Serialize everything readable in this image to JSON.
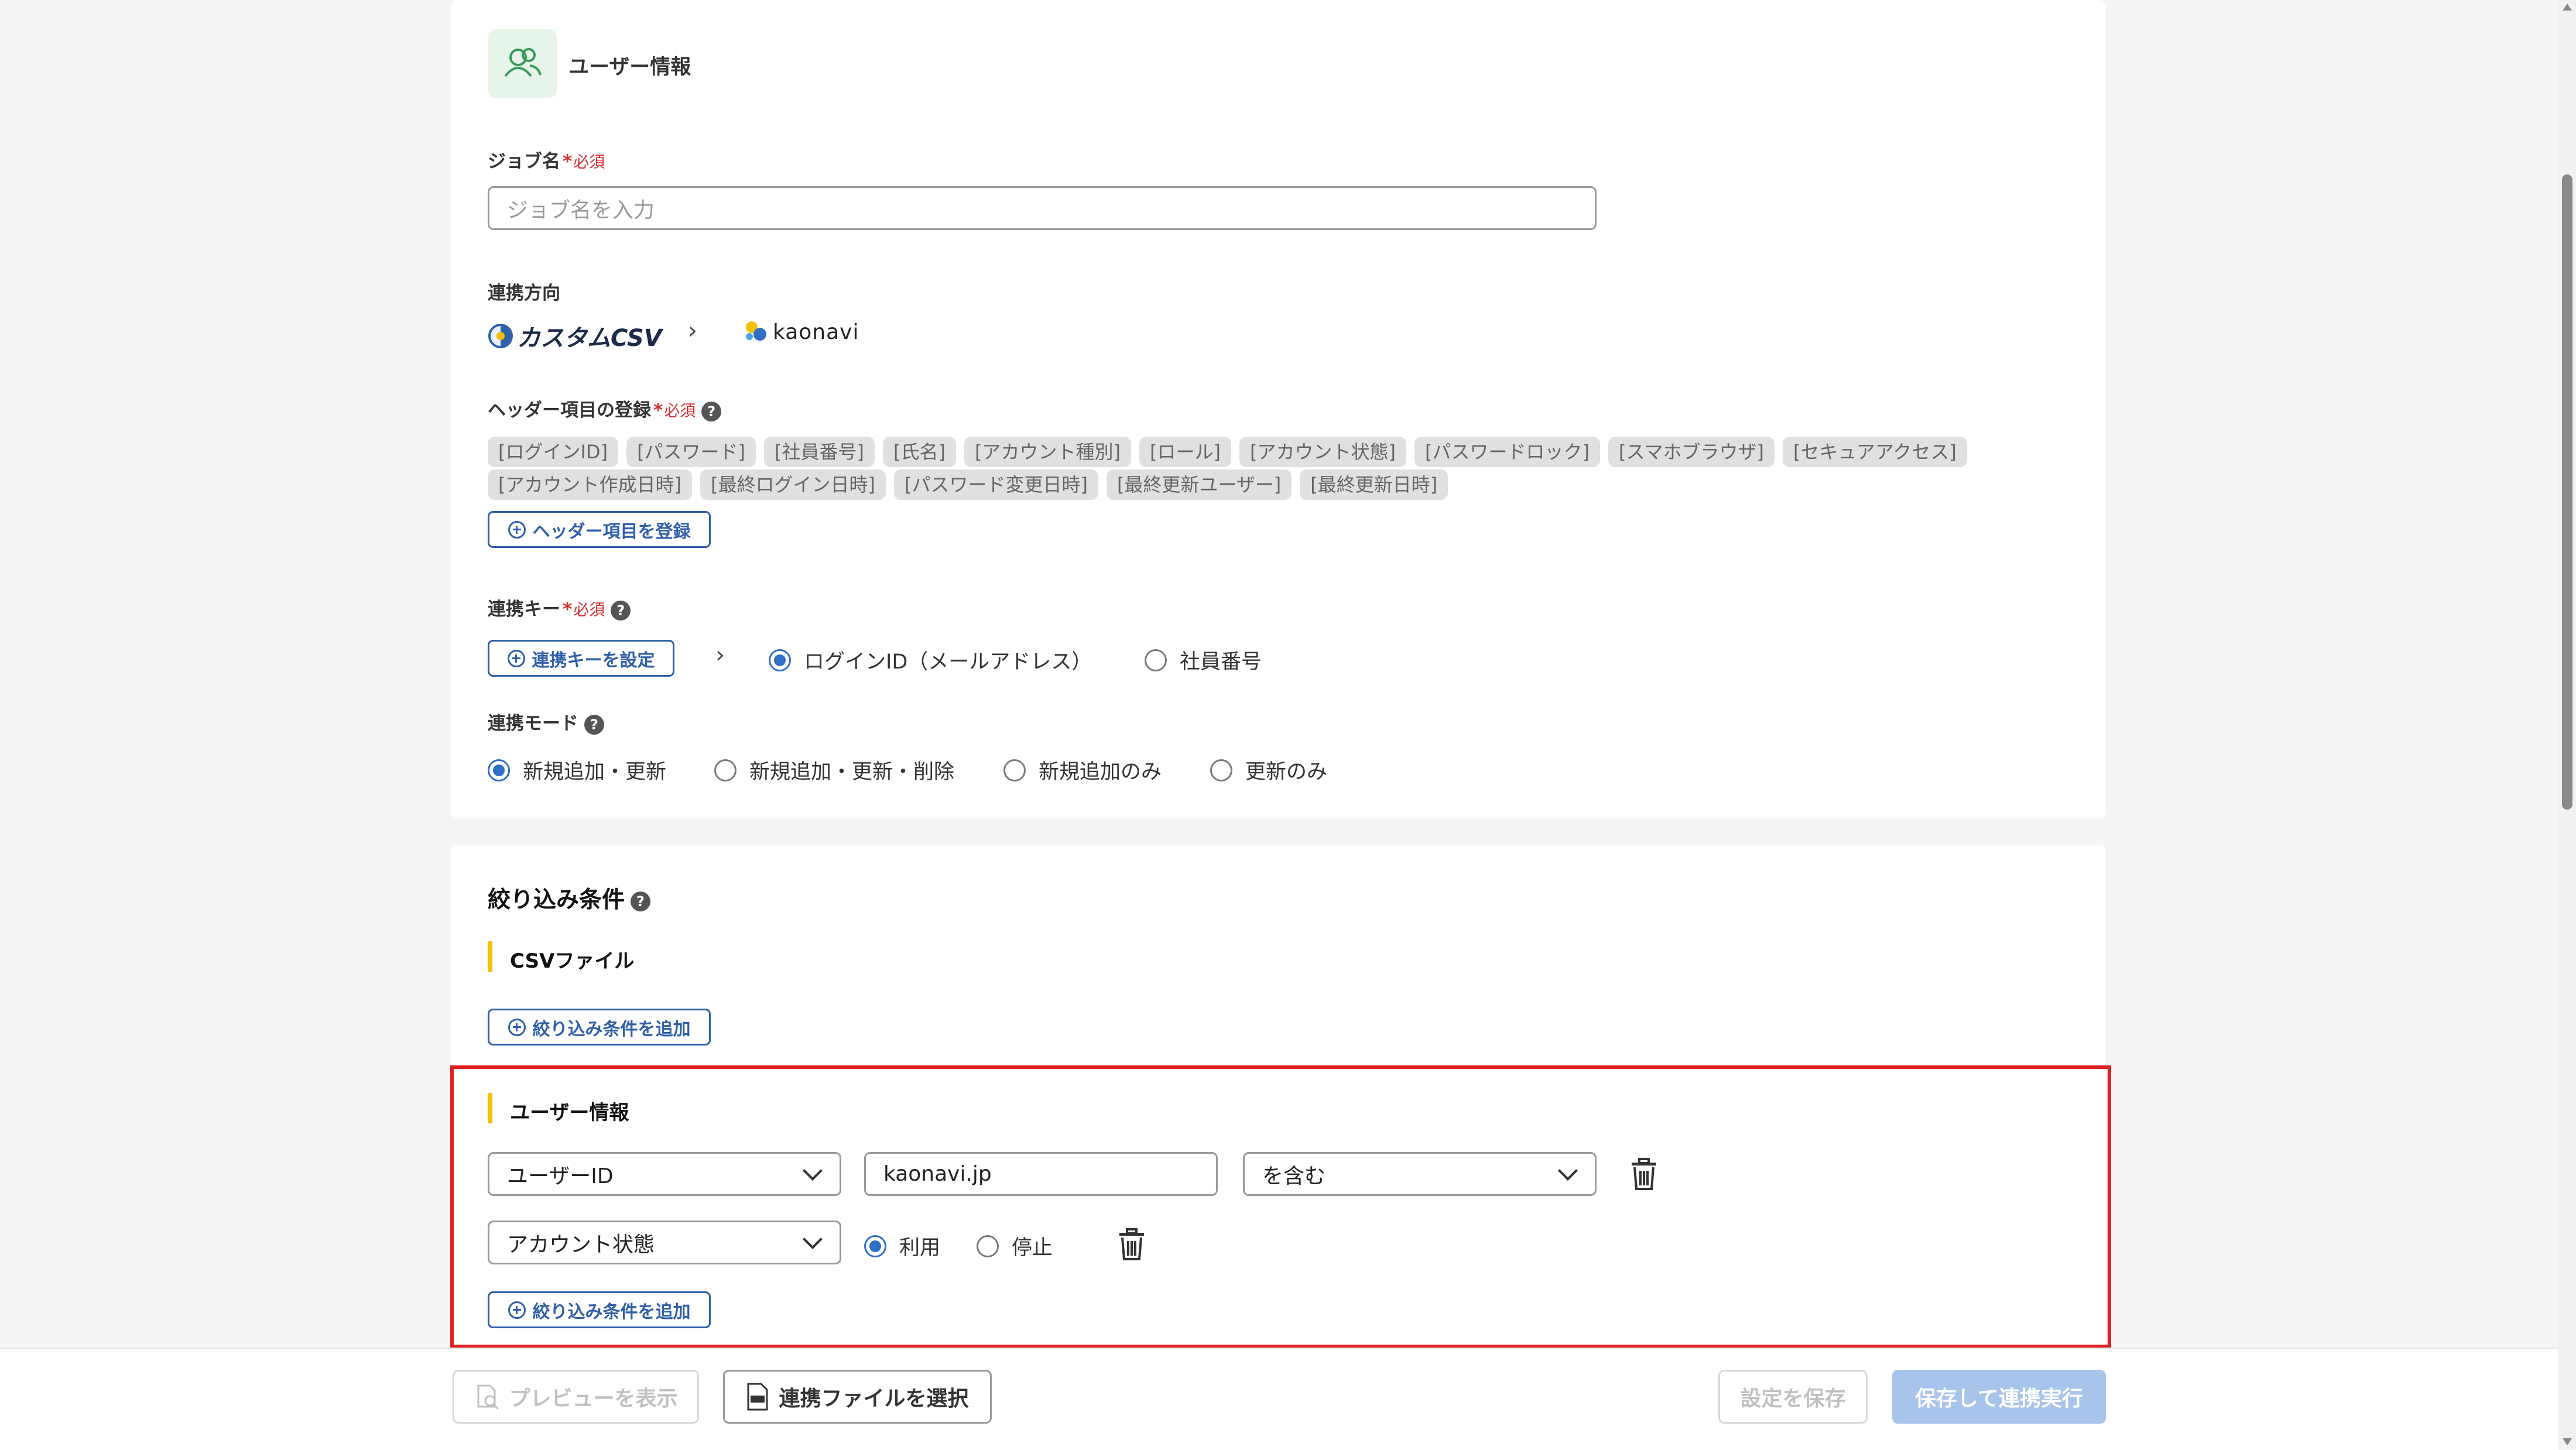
{
  "user_info": {
    "title": "ユーザー情報",
    "job_name": {
      "label": "ジョブ名",
      "required_mark": "*",
      "required_text": "必須",
      "placeholder": "ジョブ名を入力"
    },
    "direction": {
      "label": "連携方向",
      "source": "カスタムCSV",
      "target": "kaonavi"
    },
    "header_items": {
      "label": "ヘッダー項目の登録",
      "required_mark": "*",
      "required_text": "必須",
      "chips_row1": [
        "[ログインID]",
        "[パスワード]",
        "[社員番号]",
        "[氏名]",
        "[アカウント種別]",
        "[ロール]",
        "[アカウント状態]",
        "[パスワードロック]",
        "[スマホブラウザ]",
        "[セキュアアクセス]"
      ],
      "chips_row2": [
        "[アカウント作成日時]",
        "[最終ログイン日時]",
        "[パスワード変更日時]",
        "[最終更新ユーザー]",
        "[最終更新日時]"
      ],
      "button": "ヘッダー項目を登録"
    },
    "key": {
      "label": "連携キー",
      "required_mark": "*",
      "required_text": "必須",
      "button": "連携キーを設定",
      "options": [
        "ログインID（メールアドレス）",
        "社員番号"
      ],
      "selected": "ログインID（メールアドレス）"
    },
    "mode": {
      "label": "連携モード",
      "options": [
        "新規追加・更新",
        "新規追加・更新・削除",
        "新規追加のみ",
        "更新のみ"
      ],
      "selected": "新規追加・更新"
    }
  },
  "filter": {
    "title": "絞り込み条件",
    "csv_section": {
      "title": "CSVファイル",
      "add_button": "絞り込み条件を追加"
    },
    "user_section": {
      "title": "ユーザー情報",
      "row1": {
        "field": "ユーザーID",
        "value": "kaonavi.jp",
        "operator": "を含む"
      },
      "row2": {
        "field": "アカウント状態",
        "options": [
          "利用",
          "停止"
        ],
        "selected": "利用"
      },
      "add_button": "絞り込み条件を追加"
    }
  },
  "footer": {
    "preview": "プレビューを表示",
    "select_file": "連携ファイルを選択",
    "save": "設定を保存",
    "save_run": "保存して連携実行"
  },
  "colors": {
    "accent": "#2f5fa8",
    "highlight": "#e02020",
    "section_bar": "#f2c200",
    "primary_disabled": "#a9c4ea"
  }
}
